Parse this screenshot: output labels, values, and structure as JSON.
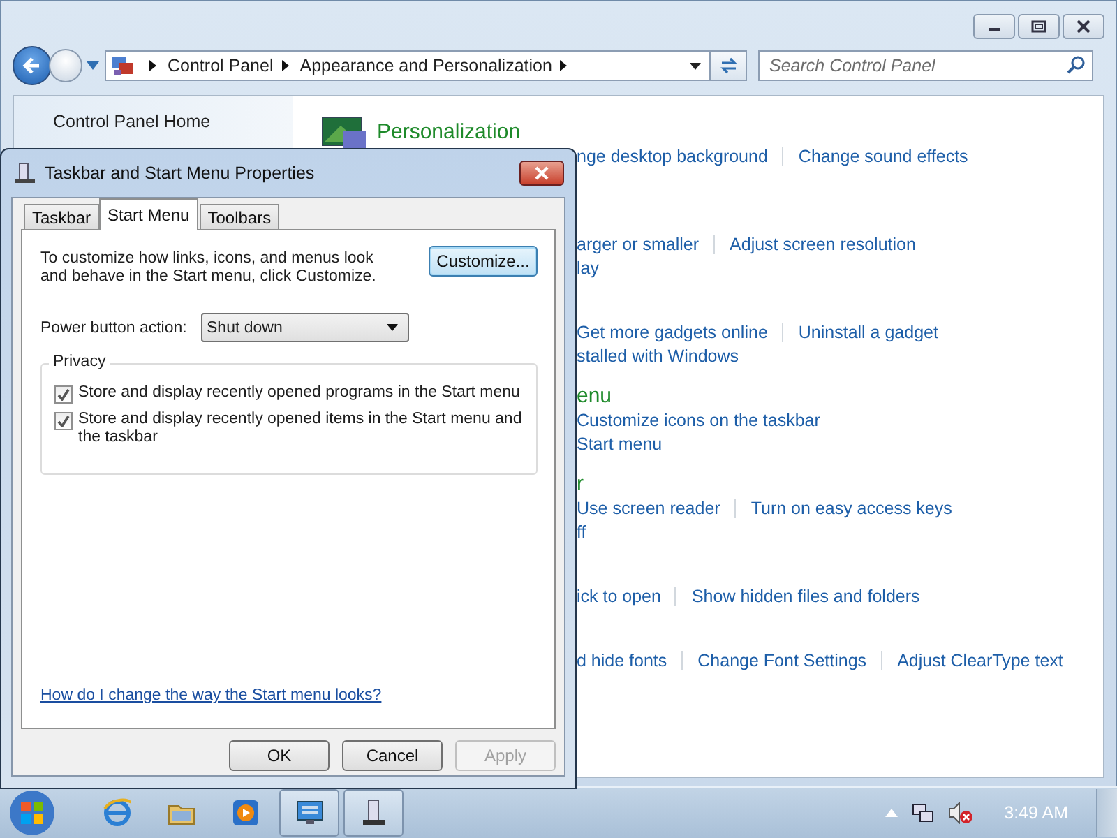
{
  "window": {
    "breadcrumb": [
      "Control Panel",
      "Appearance and Personalization"
    ],
    "search": {
      "placeholder": "Search Control Panel"
    }
  },
  "sidebar": {
    "items": [
      {
        "label": "Control Panel Home"
      }
    ]
  },
  "sections": [
    {
      "title": "Personalization",
      "icon": true,
      "lines": [
        [
          "nge desktop background",
          "Change sound effects"
        ]
      ]
    },
    {
      "lines": [
        [
          "arger or smaller",
          "Adjust screen resolution"
        ],
        [
          "lay"
        ]
      ]
    },
    {
      "lines": [
        [
          "Get more gadgets online",
          "Uninstall a gadget"
        ],
        [
          "stalled with Windows"
        ]
      ]
    },
    {
      "title": "enu",
      "lines": [
        [
          "Customize icons on the taskbar"
        ],
        [
          "Start menu"
        ]
      ]
    },
    {
      "title": "r",
      "lines": [
        [
          "Use screen reader",
          "Turn on easy access keys"
        ],
        [
          "ff"
        ]
      ]
    },
    {
      "lines": [
        [
          "ick to open",
          "Show hidden files and folders"
        ]
      ]
    },
    {
      "lines": [
        [
          "d hide fonts",
          "Change Font Settings",
          "Adjust ClearType text"
        ]
      ]
    }
  ],
  "dialog": {
    "title": "Taskbar and Start Menu Properties",
    "tabs": [
      {
        "label": "Taskbar",
        "selected": false
      },
      {
        "label": "Start Menu",
        "selected": true
      },
      {
        "label": "Toolbars",
        "selected": false
      }
    ],
    "intro": "To customize how links, icons, and menus look and behave in the Start menu, click Customize.",
    "customize_button": "Customize...",
    "power": {
      "label": "Power button action:",
      "value": "Shut down"
    },
    "privacy": {
      "title": "Privacy",
      "options": [
        {
          "label": "Store and display recently opened programs in the Start menu",
          "checked": true
        },
        {
          "label": "Store and display recently opened items in the Start menu and the taskbar",
          "checked": true
        }
      ]
    },
    "help_link": "How do I change the way the Start menu looks?",
    "buttons": [
      {
        "label": "OK",
        "disabled": false
      },
      {
        "label": "Cancel",
        "disabled": false
      },
      {
        "label": "Apply",
        "disabled": true
      }
    ]
  },
  "taskbar": {
    "items": [
      {
        "kind": "browser",
        "running": false
      },
      {
        "kind": "folder",
        "running": false
      },
      {
        "kind": "media",
        "running": false
      },
      {
        "kind": "display",
        "running": true
      },
      {
        "kind": "taskbar",
        "running": true
      }
    ],
    "clock": "3:49 AM"
  }
}
